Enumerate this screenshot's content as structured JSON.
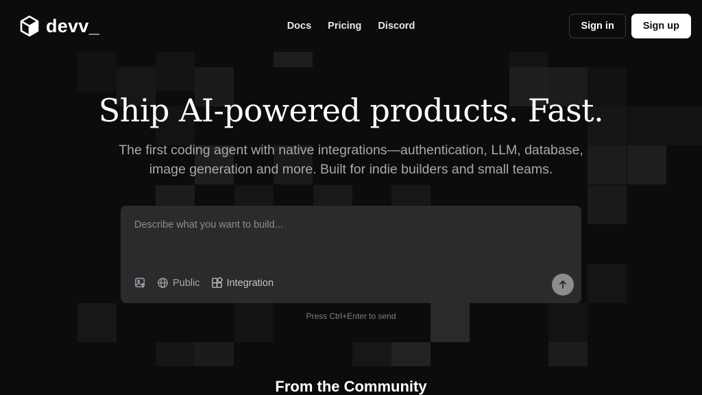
{
  "header": {
    "brand": "devv_",
    "nav": [
      "Docs",
      "Pricing",
      "Discord"
    ],
    "signin_label": "Sign in",
    "signup_label": "Sign up"
  },
  "hero": {
    "title": "Ship AI-powered products. Fast.",
    "subtitle_line1": "The first coding agent with native integrations—authentication, LLM, database,",
    "subtitle_line2": "image generation and more. Built for indie builders and small teams."
  },
  "prompt": {
    "placeholder": "Describe what you want to build...",
    "value": "",
    "tools": {
      "image_icon": "image-upload-icon",
      "public_label": "Public",
      "public_icon": "globe-icon",
      "integration_label": "Integration",
      "integration_icon": "integration-icon"
    },
    "send_icon": "arrow-up-icon"
  },
  "hint": "Press Ctrl+Enter to send",
  "community_heading": "From the Community",
  "colors": {
    "background": "#0c0c0d",
    "panel": "#2b2b2d",
    "send_button": "#8d8d8f",
    "muted_text": "#a9a9ad"
  }
}
